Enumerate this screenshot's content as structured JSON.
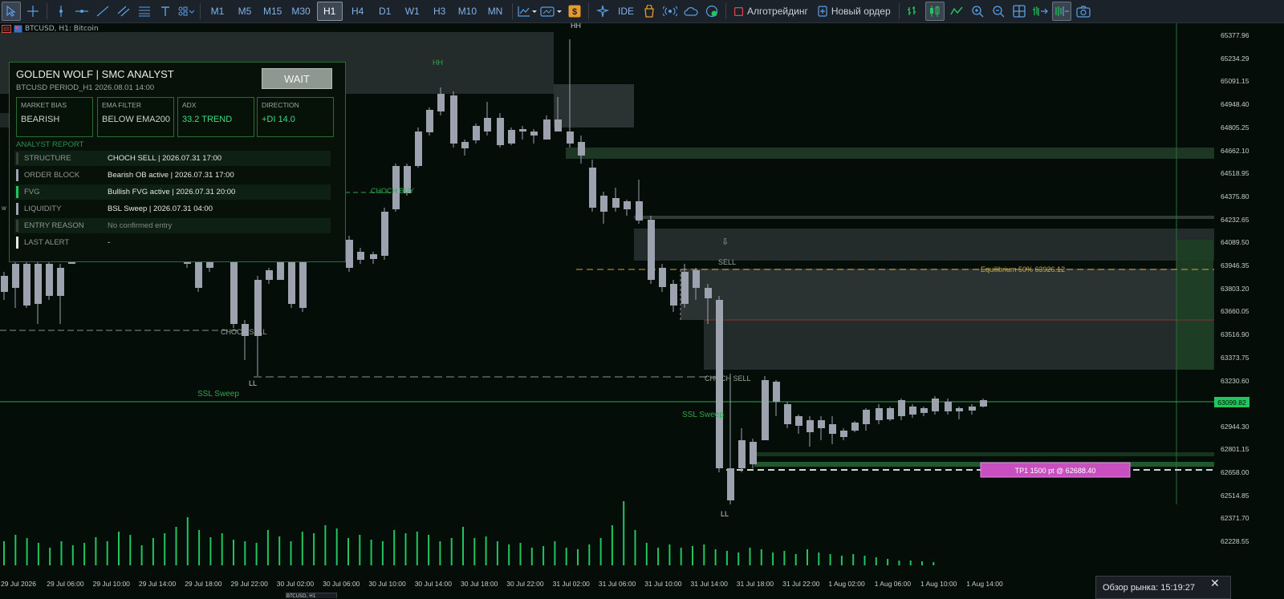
{
  "toolbar": {
    "timeframes": [
      "M1",
      "M5",
      "M15",
      "M30",
      "H1",
      "H4",
      "D1",
      "W1",
      "H3",
      "M10",
      "MN"
    ],
    "active_timeframe": "H1",
    "ide_label": "IDE",
    "algotrading_label": "Алготрейдинг",
    "new_order_label": "Новый ордер"
  },
  "chart_tab": {
    "symbol": "BTCUSD, H1: Bitcoin"
  },
  "panel": {
    "title": "GOLDEN WOLF  |  SMC ANALYST",
    "subtitle": "BTCUSD  PERIOD_H1  2026.08.01 14:00",
    "wait_button": "WAIT",
    "cards": [
      {
        "label": "MARKET BIAS",
        "value": "BEARISH"
      },
      {
        "label": "EMA FILTER",
        "value": "BELOW EMA200"
      },
      {
        "label": "ADX",
        "value": "33.2 TREND"
      },
      {
        "label": "DIRECTION",
        "value": "+DI 14.0"
      }
    ],
    "report_title": "ANALYST REPORT",
    "report": [
      {
        "key": "STRUCTURE",
        "value": "CHOCH SELL | 2026.07.31 17:00"
      },
      {
        "key": "ORDER BLOCK",
        "value": "Bearish OB active | 2026.07.31 17:00"
      },
      {
        "key": "FVG",
        "value": "Bullish FVG active | 2026.07.31 20:00"
      },
      {
        "key": "LIQUIDITY",
        "value": "BSL Sweep | 2026.07.31 04:00"
      },
      {
        "key": "ENTRY REASON",
        "value": "No confirmed entry"
      },
      {
        "key": "LAST ALERT",
        "value": "-"
      }
    ],
    "colors": {
      "border": "#2a6b3a",
      "accent": "#3ddc84"
    }
  },
  "chart_labels": {
    "hh1": "HH",
    "hh2": "HH",
    "choch_buy": "CHOCH BUY",
    "choch_sell1": "CHOCH SELL",
    "choch_sell2": "CHOCH SELL",
    "ll1": "LL",
    "ll2": "LL",
    "ssl1": "SSL Sweep",
    "ssl2": "SSL Sweep",
    "sell": "SELL",
    "equilibrium": "Equilibrium 50%  63926.12",
    "tp": "TP1  1500 pt @ 62688.40",
    "w": "w"
  },
  "price_axis": {
    "labels": [
      "65377.96",
      "65234.29",
      "65091.15",
      "64948.40",
      "64805.25",
      "64662.10",
      "64518.95",
      "64375.80",
      "64232.65",
      "64089.50",
      "63946.35",
      "63803.20",
      "63660.05",
      "63516.90",
      "63373.75",
      "63230.60",
      "62944.30",
      "62801.15",
      "62658.00",
      "62514.85",
      "62371.70",
      "62228.55"
    ],
    "current": "63099.82"
  },
  "time_axis": [
    "29 Jul 2026",
    "29 Jul 06:00",
    "29 Jul 10:00",
    "29 Jul 14:00",
    "29 Jul 18:00",
    "29 Jul 22:00",
    "30 Jul 02:00",
    "30 Jul 06:00",
    "30 Jul 10:00",
    "30 Jul 14:00",
    "30 Jul 18:00",
    "30 Jul 22:00",
    "31 Jul 02:00",
    "31 Jul 06:00",
    "31 Jul 10:00",
    "31 Jul 14:00",
    "31 Jul 18:00",
    "31 Jul 22:00",
    "1 Aug 02:00",
    "1 Aug 06:00",
    "1 Aug 10:00",
    "1 Aug 14:00"
  ],
  "market_overview": {
    "label": "Обзор рынка: 15:19:27"
  },
  "bottom_tab": {
    "label": "BTCUSD, H1"
  },
  "colors": {
    "bull": "#22c55e",
    "bear": "#9ca3af",
    "background": "#040d08"
  }
}
